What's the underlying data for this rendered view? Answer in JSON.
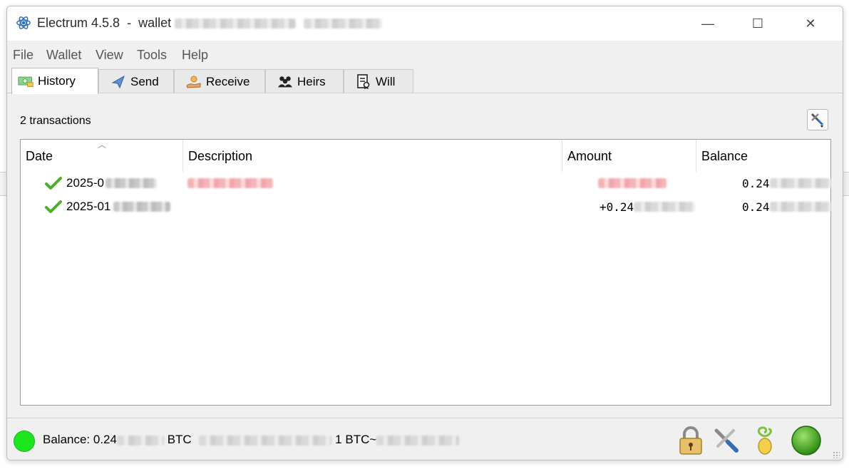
{
  "window": {
    "app_name": "Electrum 4.5.8",
    "title_sep": "-",
    "title_wallet_label": "wallet",
    "controls": {
      "minimize": "—",
      "maximize": "☐",
      "close": "✕"
    }
  },
  "menu": [
    "File",
    "Wallet",
    "View",
    "Tools",
    "Help"
  ],
  "tabs": [
    {
      "label": "History",
      "icon": "history-icon",
      "active": true
    },
    {
      "label": "Send",
      "icon": "send-icon",
      "active": false
    },
    {
      "label": "Receive",
      "icon": "receive-icon",
      "active": false
    },
    {
      "label": "Heirs",
      "icon": "heirs-icon",
      "active": false
    },
    {
      "label": "Will",
      "icon": "will-icon",
      "active": false
    }
  ],
  "history": {
    "count_text": "2 transactions",
    "columns": [
      "Date",
      "Description",
      "Amount",
      "Balance"
    ],
    "rows": [
      {
        "date_visible": "2025-0",
        "amount_visible": "",
        "balance_visible": "0.24",
        "status_icon": "confirmed-check-icon"
      },
      {
        "date_visible": "2025-01",
        "amount_visible": "+0.24",
        "balance_visible": "0.24",
        "status_icon": "confirmed-check-icon"
      }
    ]
  },
  "status": {
    "balance_prefix": "Balance: 0.24",
    "unit": "BTC",
    "rate_text": "1 BTC~",
    "connection_color": "#1ee61e",
    "icons": [
      "lock-icon",
      "preferences-icon",
      "seed-icon",
      "network-status-icon"
    ]
  },
  "colors": {
    "negative_amount": "#e05a63",
    "window_bg": "#f0f0f0"
  }
}
